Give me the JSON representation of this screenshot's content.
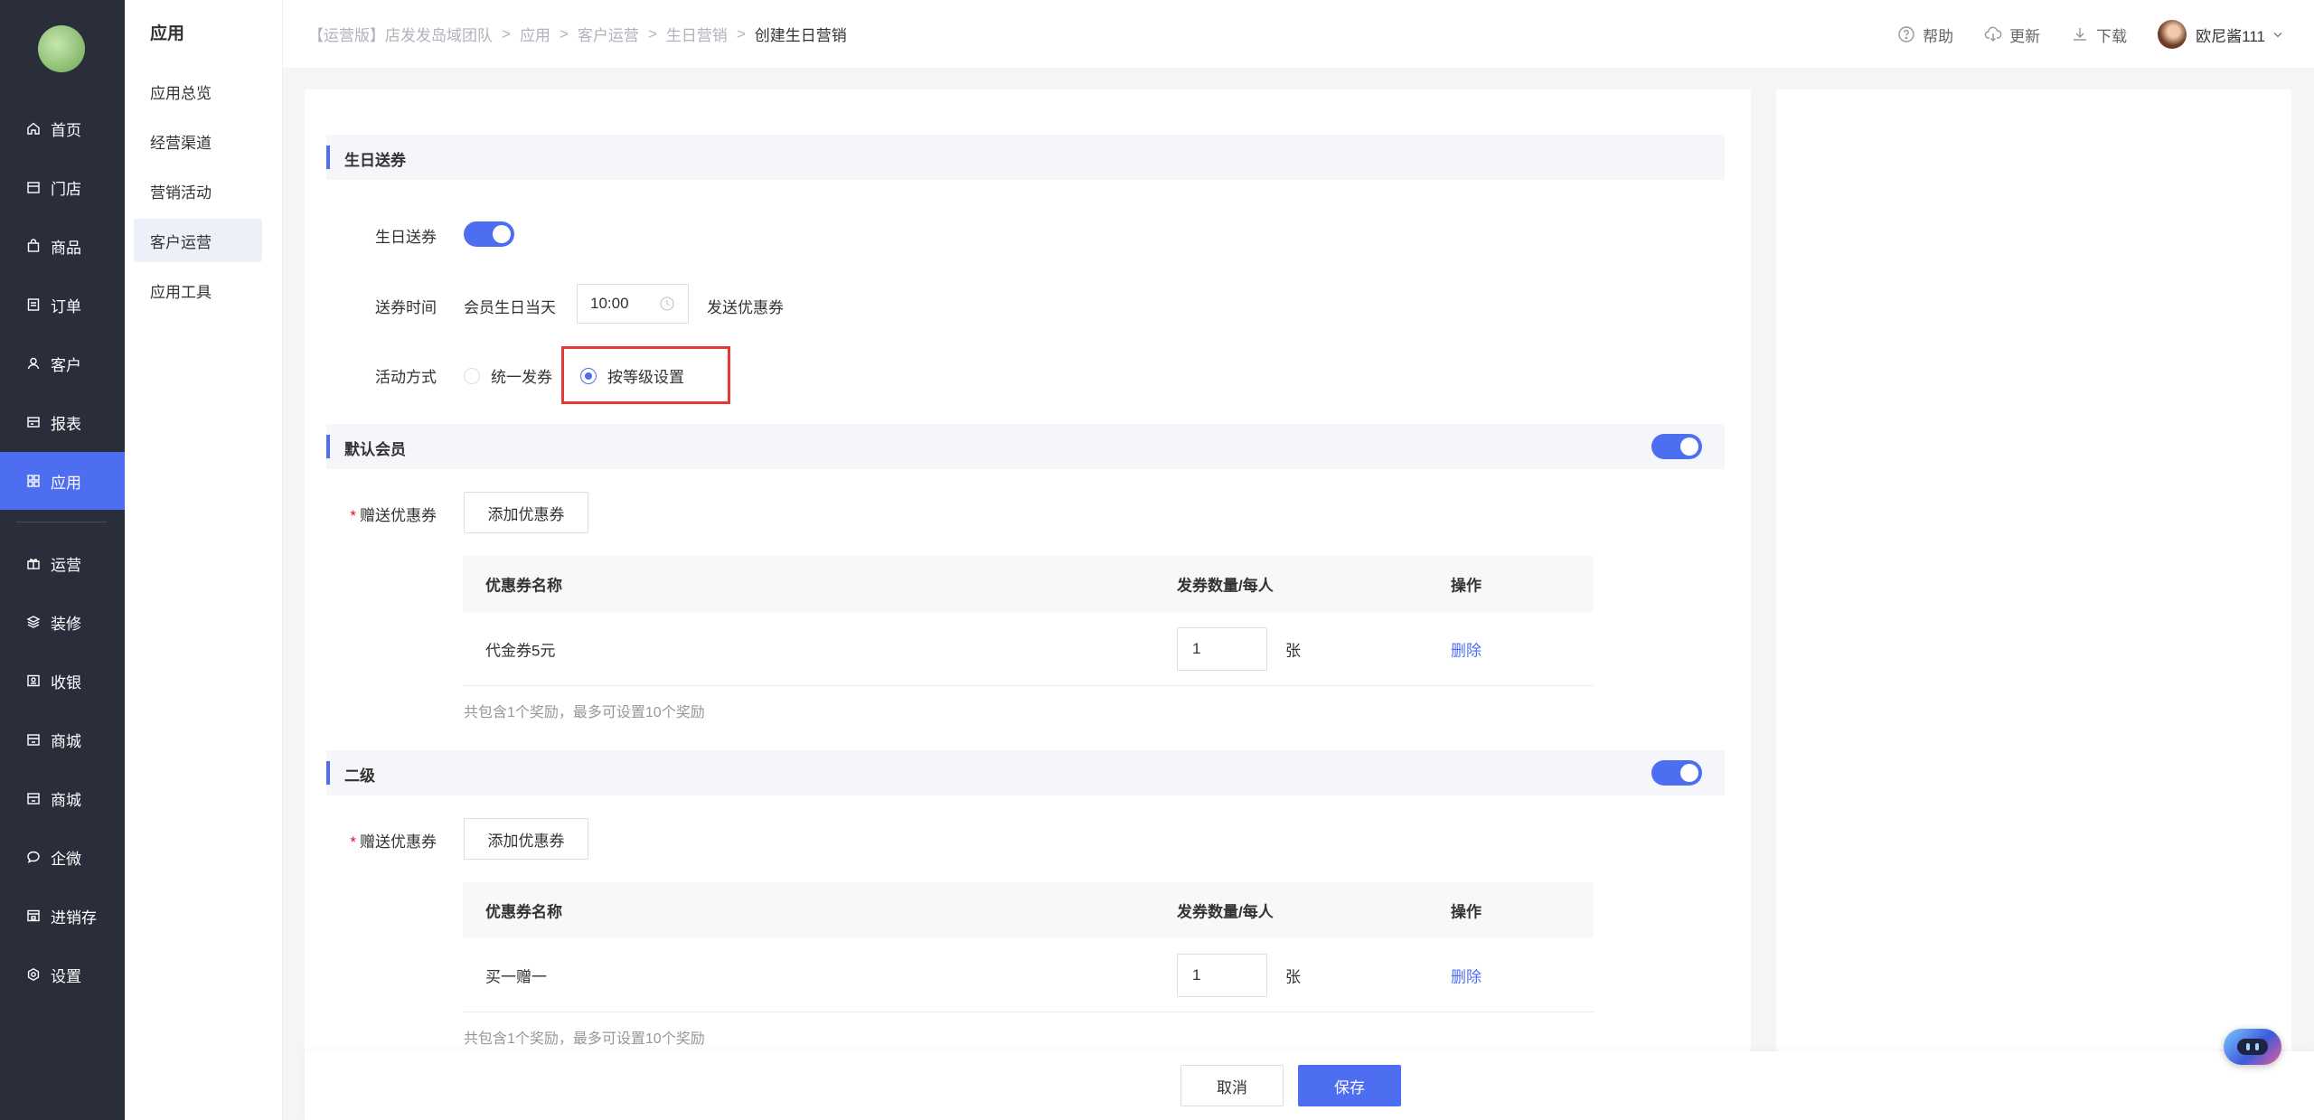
{
  "leftnav": {
    "items": [
      {
        "label": "首页",
        "icon": "home-icon"
      },
      {
        "label": "门店",
        "icon": "store-icon"
      },
      {
        "label": "商品",
        "icon": "bag-icon"
      },
      {
        "label": "订单",
        "icon": "order-icon"
      },
      {
        "label": "客户",
        "icon": "user-icon"
      },
      {
        "label": "报表",
        "icon": "report-icon"
      },
      {
        "label": "应用",
        "icon": "apps-icon",
        "active": true
      },
      {
        "label": "运营",
        "icon": "gift-icon"
      },
      {
        "label": "装修",
        "icon": "layers-icon"
      },
      {
        "label": "收银",
        "icon": "cashier-icon"
      },
      {
        "label": "商城",
        "icon": "shop-icon"
      },
      {
        "label": "商城",
        "icon": "shop-icon"
      },
      {
        "label": "企微",
        "icon": "chat-icon"
      },
      {
        "label": "进销存",
        "icon": "inventory-icon"
      },
      {
        "label": "设置",
        "icon": "settings-icon"
      }
    ]
  },
  "subnav": {
    "title": "应用",
    "items": [
      {
        "label": "应用总览"
      },
      {
        "label": "经营渠道"
      },
      {
        "label": "营销活动"
      },
      {
        "label": "客户运营",
        "active": true
      },
      {
        "label": "应用工具"
      }
    ]
  },
  "header": {
    "breadcrumb": [
      "【运营版】店发发岛域团队",
      "应用",
      "客户运营",
      "生日营销",
      "创建生日营销"
    ],
    "help": "帮助",
    "update": "更新",
    "download": "下载",
    "user": "欧尼酱111"
  },
  "form": {
    "section_birthday": "生日送券",
    "birthday_toggle_label": "生日送券",
    "birthday_toggle_on": true,
    "send_time_label": "送券时间",
    "send_time_prefix": "会员生日当天",
    "send_time_value": "10:00",
    "send_time_suffix": "发送优惠券",
    "mode_label": "活动方式",
    "mode_options": [
      "统一发券",
      "按等级设置"
    ],
    "mode_selected": "按等级设置"
  },
  "levels": [
    {
      "title": "默认会员",
      "enabled": true,
      "gift_label": "赠送优惠券",
      "add_button": "添加优惠券",
      "columns": [
        "优惠券名称",
        "发券数量/每人",
        "操作"
      ],
      "rows": [
        {
          "name": "代金券5元",
          "qty": "1",
          "unit": "张",
          "action": "删除"
        }
      ],
      "note": "共包含1个奖励，最多可设置10个奖励"
    },
    {
      "title": "二级",
      "enabled": true,
      "gift_label": "赠送优惠券",
      "add_button": "添加优惠券",
      "columns": [
        "优惠券名称",
        "发券数量/每人",
        "操作"
      ],
      "rows": [
        {
          "name": "买一赠一",
          "qty": "1",
          "unit": "张",
          "action": "删除"
        }
      ],
      "note": "共包含1个奖励，最多可设置10个奖励"
    }
  ],
  "footer": {
    "cancel": "取消",
    "save": "保存"
  },
  "colors": {
    "accent": "#4e6ef2",
    "nav_bg": "#2a2e3b",
    "highlight": "#e53935"
  }
}
